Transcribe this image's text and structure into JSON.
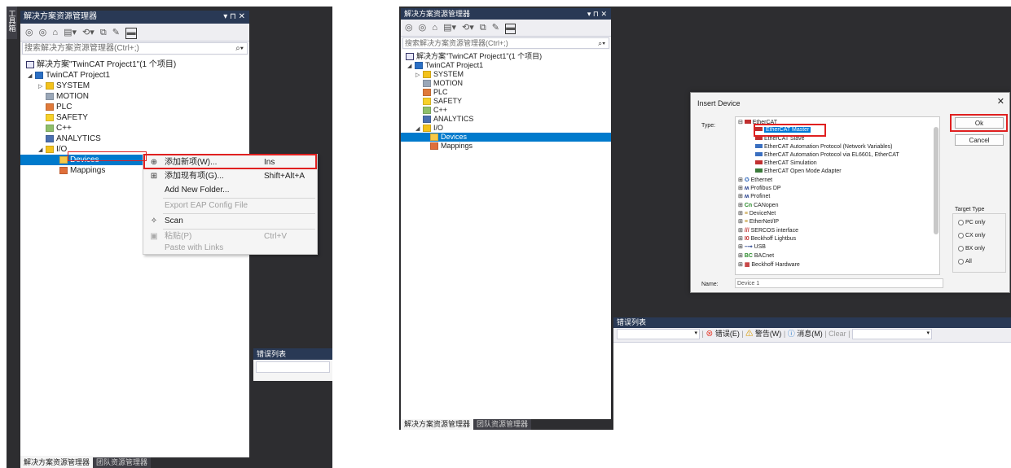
{
  "left": {
    "side_tab": "工具箱",
    "title": "解决方案资源管理器",
    "title_buttons": "▾ ⊓ ✕",
    "search_placeholder": "搜索解决方案资源管理器(Ctrl+;)",
    "tree": [
      {
        "label": "解决方案\"TwinCAT Project1\"(1 个项目)",
        "indent": 0,
        "icon": "solution-icon"
      },
      {
        "label": "TwinCAT Project1",
        "indent": 1,
        "icon": "project-icon"
      },
      {
        "label": "SYSTEM",
        "indent": 2,
        "icon": "system-icon"
      },
      {
        "label": "MOTION",
        "indent": 2,
        "icon": "motion-icon"
      },
      {
        "label": "PLC",
        "indent": 2,
        "icon": "plc-icon"
      },
      {
        "label": "SAFETY",
        "indent": 2,
        "icon": "safety-icon"
      },
      {
        "label": "C++",
        "indent": 2,
        "icon": "cpp-icon"
      },
      {
        "label": "ANALYTICS",
        "indent": 2,
        "icon": "analytics-icon"
      },
      {
        "label": "I/O",
        "indent": 2,
        "icon": "io-icon"
      },
      {
        "label": "Devices",
        "indent": 3,
        "icon": "devices-icon"
      },
      {
        "label": "Mappings",
        "indent": 3,
        "icon": "mappings-icon"
      }
    ],
    "context_menu": [
      {
        "label": "添加新项(W)...",
        "shortcut": "Ins",
        "icon": "add-new-item-icon"
      },
      {
        "label": "添加现有项(G)...",
        "shortcut": "Shift+Alt+A",
        "icon": "add-existing-item-icon"
      },
      {
        "label": "Add New Folder...",
        "shortcut": "",
        "icon": ""
      },
      {
        "label": "Export EAP Config File",
        "shortcut": "",
        "icon": ""
      },
      {
        "label": "Scan",
        "shortcut": "",
        "icon": "scan-icon"
      },
      {
        "label": "粘贴(P)",
        "shortcut": "Ctrl+V",
        "icon": "paste-icon"
      },
      {
        "label": "Paste with Links",
        "shortcut": "",
        "icon": ""
      }
    ],
    "tabs": [
      "解决方案资源管理器",
      "团队资源管理器"
    ],
    "error_list_title": "错误列表"
  },
  "right": {
    "title": "解决方案资源管理器",
    "title_buttons": "▾ ⊓ ✕",
    "search_placeholder": "搜索解决方案资源管理器(Ctrl+;)",
    "tree": [
      {
        "label": "解决方案\"TwinCAT Project1\"(1 个项目)",
        "indent": 0
      },
      {
        "label": "TwinCAT Project1",
        "indent": 1
      },
      {
        "label": "SYSTEM",
        "indent": 2
      },
      {
        "label": "MOTION",
        "indent": 2
      },
      {
        "label": "PLC",
        "indent": 2
      },
      {
        "label": "SAFETY",
        "indent": 2
      },
      {
        "label": "C++",
        "indent": 2
      },
      {
        "label": "ANALYTICS",
        "indent": 2
      },
      {
        "label": "I/O",
        "indent": 2
      },
      {
        "label": "Devices",
        "indent": 3
      },
      {
        "label": "Mappings",
        "indent": 3
      }
    ],
    "tabs": [
      "解决方案资源管理器",
      "团队资源管理器"
    ],
    "dialog": {
      "title": "Insert Device",
      "close": "✕",
      "type_label": "Type:",
      "name_label": "Name:",
      "name_value": "Device 1",
      "ok": "Ok",
      "cancel": "Cancel",
      "target_type_label": "Target Type",
      "radios": [
        "PC only",
        "CX only",
        "BX only",
        "All"
      ],
      "items": [
        {
          "label": "EtherCAT",
          "level": 0
        },
        {
          "label": "EtherCAT Master",
          "level": 1
        },
        {
          "label": "EtherCAT Slave",
          "level": 1
        },
        {
          "label": "EtherCAT Automation Protocol (Network Variables)",
          "level": 1
        },
        {
          "label": "EtherCAT Automation Protocol via EL6601, EtherCAT",
          "level": 1
        },
        {
          "label": "EtherCAT Simulation",
          "level": 1
        },
        {
          "label": "EtherCAT Open Mode Adapter",
          "level": 1
        },
        {
          "label": "Ethernet",
          "level": 0
        },
        {
          "label": "Profibus DP",
          "level": 0
        },
        {
          "label": "Profinet",
          "level": 0
        },
        {
          "label": "CANopen",
          "level": 0
        },
        {
          "label": "DeviceNet",
          "level": 0
        },
        {
          "label": "EtherNet/IP",
          "level": 0
        },
        {
          "label": "SERCOS interface",
          "level": 0
        },
        {
          "label": "Beckhoff Lightbus",
          "level": 0
        },
        {
          "label": "USB",
          "level": 0
        },
        {
          "label": "BACnet",
          "level": 0
        },
        {
          "label": "Beckhoff Hardware",
          "level": 0
        }
      ]
    },
    "error_list": {
      "title": "错误列表",
      "errors": "错误(E)",
      "warnings": "警告(W)",
      "messages": "消息(M)",
      "clear": "Clear"
    }
  }
}
